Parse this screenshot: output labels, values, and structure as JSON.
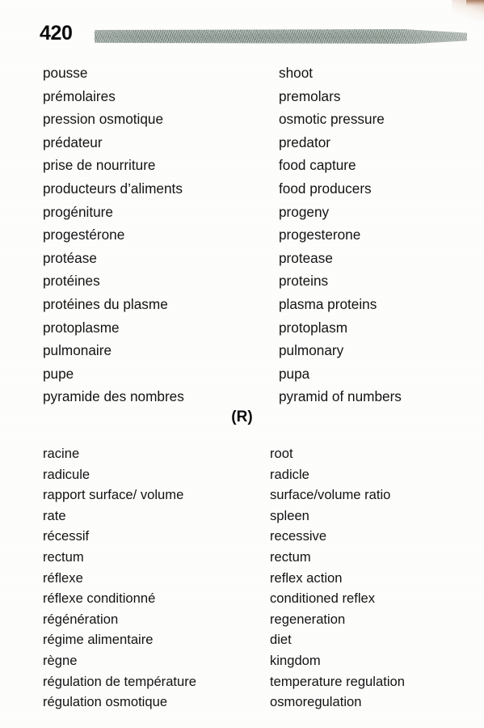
{
  "page": {
    "number": "420",
    "background_color": "#fdfdfc",
    "rule_color": "#b9c3bd",
    "text_color": "#131313"
  },
  "sections": [
    {
      "id": "p",
      "heading": "",
      "entries": [
        {
          "term": "pousse",
          "gloss": "shoot"
        },
        {
          "term": "prémolaires",
          "gloss": "premolars"
        },
        {
          "term": "pression osmotique",
          "gloss": "osmotic pressure"
        },
        {
          "term": "prédateur",
          "gloss": "predator"
        },
        {
          "term": "prise de nourriture",
          "gloss": "food capture"
        },
        {
          "term": "producteurs d’aliments",
          "gloss": "food producers"
        },
        {
          "term": "progéniture",
          "gloss": "progeny"
        },
        {
          "term": "progestérone",
          "gloss": "progesterone"
        },
        {
          "term": "protéase",
          "gloss": "protease"
        },
        {
          "term": "protéines",
          "gloss": "proteins"
        },
        {
          "term": "protéines du plasme",
          "gloss": "plasma proteins"
        },
        {
          "term": "protoplasme",
          "gloss": "protoplasm"
        },
        {
          "term": "pulmonaire",
          "gloss": "pulmonary"
        },
        {
          "term": "pupe",
          "gloss": "pupa"
        },
        {
          "term": "pyramide des nombres",
          "gloss": "pyramid of numbers"
        }
      ]
    },
    {
      "id": "r",
      "heading": "(R)",
      "entries": [
        {
          "term": "racine",
          "gloss": "root"
        },
        {
          "term": "radicule",
          "gloss": "radicle"
        },
        {
          "term": "rapport surface/ volume",
          "gloss": "surface/volume ratio"
        },
        {
          "term": "rate",
          "gloss": "spleen"
        },
        {
          "term": "récessif",
          "gloss": "recessive"
        },
        {
          "term": "rectum",
          "gloss": "rectum"
        },
        {
          "term": "réflexe",
          "gloss": "reflex action"
        },
        {
          "term": "réflexe conditionné",
          "gloss": "conditioned reflex"
        },
        {
          "term": "régénération",
          "gloss": "regeneration"
        },
        {
          "term": "régime alimentaire",
          "gloss": "diet"
        },
        {
          "term": "règne",
          "gloss": "kingdom"
        },
        {
          "term": "régulation de température",
          "gloss": "temperature regulation"
        },
        {
          "term": "régulation osmotique",
          "gloss": "osmoregulation"
        }
      ]
    }
  ]
}
